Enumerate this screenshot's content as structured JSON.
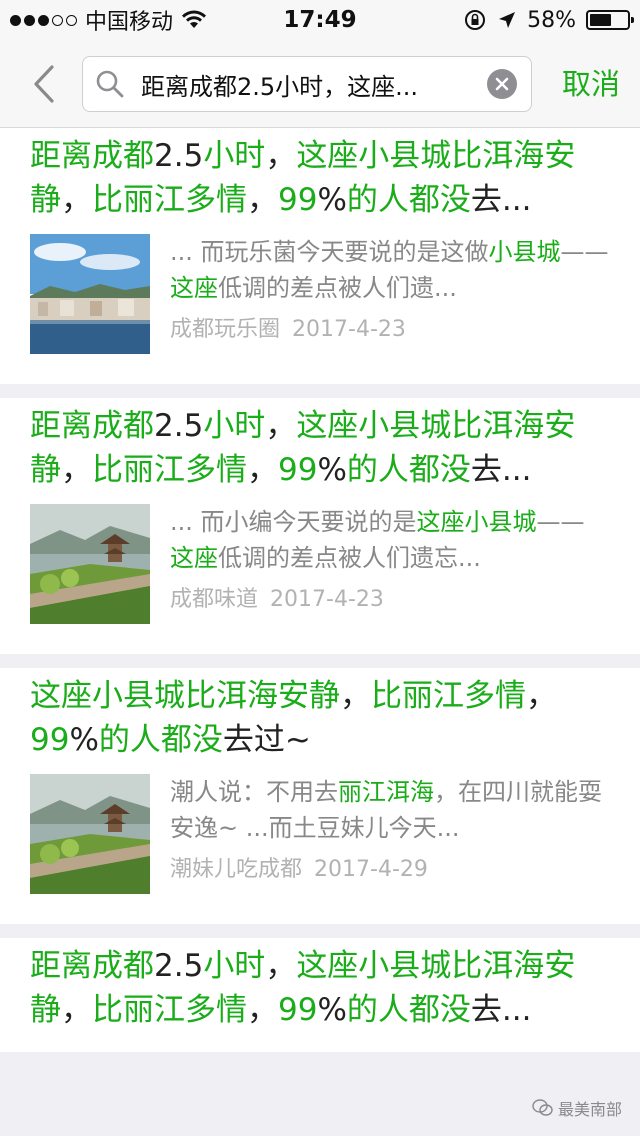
{
  "status": {
    "carrier": "中国移动",
    "time": "17:49",
    "battery": "58%",
    "battery_level": 0.58
  },
  "search": {
    "value": "距离成都2.5小时，这座...",
    "cancel_label": "取消"
  },
  "results": [
    {
      "title": [
        {
          "t": "距离成都",
          "hl": true
        },
        {
          "t": "2.5",
          "hl": false
        },
        {
          "t": "小时",
          "hl": true
        },
        {
          "t": "，",
          "hl": false
        },
        {
          "t": "这座小县城比洱海",
          "hl": true
        },
        {
          "t": "安静",
          "hl": true
        },
        {
          "t": "，",
          "hl": false
        },
        {
          "t": "比丽江多情",
          "hl": true
        },
        {
          "t": "，",
          "hl": false
        },
        {
          "t": "99",
          "hl": true
        },
        {
          "t": "%",
          "hl": false
        },
        {
          "t": "的人都没",
          "hl": true
        },
        {
          "t": "去...",
          "hl": false
        }
      ],
      "snippet": [
        {
          "t": "... 而玩乐菌今天要说的是这做",
          "hl": false
        },
        {
          "t": "小县城",
          "hl": true
        },
        {
          "t": "—— ",
          "hl": false
        },
        {
          "t": "这座",
          "hl": true
        },
        {
          "t": "低调的差点被人们遗...",
          "hl": false
        }
      ],
      "source": "成都玩乐圈",
      "date": "2017-4-23",
      "thumb": "lake-town"
    },
    {
      "title": [
        {
          "t": "距离成都",
          "hl": true
        },
        {
          "t": "2.5",
          "hl": false
        },
        {
          "t": "小时",
          "hl": true
        },
        {
          "t": "，",
          "hl": false
        },
        {
          "t": "这座小县城比洱海",
          "hl": true
        },
        {
          "t": "安静",
          "hl": true
        },
        {
          "t": "，",
          "hl": false
        },
        {
          "t": "比丽江多情",
          "hl": true
        },
        {
          "t": "，",
          "hl": false
        },
        {
          "t": "99",
          "hl": true
        },
        {
          "t": "%",
          "hl": false
        },
        {
          "t": "的人都没",
          "hl": true
        },
        {
          "t": "去...",
          "hl": false
        }
      ],
      "snippet": [
        {
          "t": "... 而小编今天要说的是",
          "hl": false
        },
        {
          "t": "这座小县城",
          "hl": true
        },
        {
          "t": "—— ",
          "hl": false
        },
        {
          "t": "这座",
          "hl": true
        },
        {
          "t": "低调的差点被人们遗忘...",
          "hl": false
        }
      ],
      "source": "成都味道",
      "date": "2017-4-23",
      "thumb": "pagoda-river"
    },
    {
      "title": [
        {
          "t": "这座小县城比洱海安静",
          "hl": true
        },
        {
          "t": "，",
          "hl": false
        },
        {
          "t": "比丽江多",
          "hl": true
        },
        {
          "t": "情",
          "hl": true
        },
        {
          "t": "，",
          "hl": false
        },
        {
          "t": "99",
          "hl": true
        },
        {
          "t": "%",
          "hl": false
        },
        {
          "t": "的人都没",
          "hl": true
        },
        {
          "t": "去过~",
          "hl": false
        }
      ],
      "snippet": [
        {
          "t": "潮人说：不用去",
          "hl": false
        },
        {
          "t": "丽江洱海",
          "hl": true
        },
        {
          "t": "，在四川就能耍安逸~ ...而土豆妹儿今天...",
          "hl": false
        }
      ],
      "source": "潮妹儿吃成都",
      "date": "2017-4-29",
      "thumb": "pagoda-river"
    },
    {
      "title": [
        {
          "t": "距离成都",
          "hl": true
        },
        {
          "t": "2.5",
          "hl": false
        },
        {
          "t": "小时",
          "hl": true
        },
        {
          "t": "，",
          "hl": false
        },
        {
          "t": "这座小县城比洱海",
          "hl": true
        },
        {
          "t": "安静",
          "hl": true
        },
        {
          "t": "，",
          "hl": false
        },
        {
          "t": "比丽江多情",
          "hl": true
        },
        {
          "t": "，",
          "hl": false
        },
        {
          "t": "99",
          "hl": true
        },
        {
          "t": "%",
          "hl": false
        },
        {
          "t": "的人都没",
          "hl": true
        },
        {
          "t": "去...",
          "hl": false
        }
      ],
      "snippet": [],
      "source": "",
      "date": "",
      "thumb": ""
    }
  ],
  "watermark": "最美南部",
  "colors": {
    "accent": "#1aad19",
    "background": "#efeff4",
    "meta": "#b2b2b2"
  }
}
